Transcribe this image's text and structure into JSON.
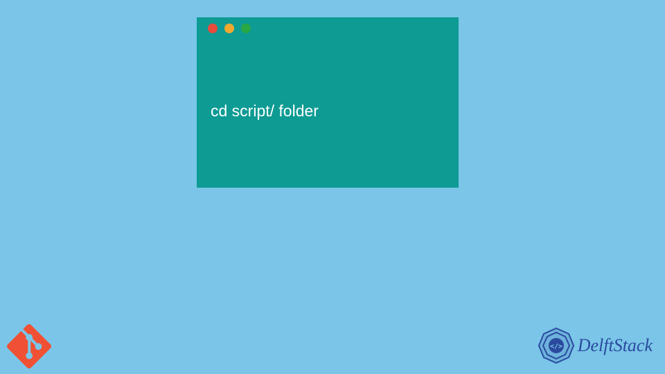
{
  "terminal": {
    "command": "cd script/ folder"
  },
  "brand": {
    "name": "DelftStack"
  },
  "colors": {
    "background": "#7ac5e8",
    "terminal_bg": "#0d9b94",
    "terminal_text": "#ffffff",
    "traffic_red": "#e84b3c",
    "traffic_yellow": "#f0a92e",
    "traffic_green": "#28a745",
    "git_orange": "#f05033",
    "brand_blue": "#2a4a9f"
  }
}
